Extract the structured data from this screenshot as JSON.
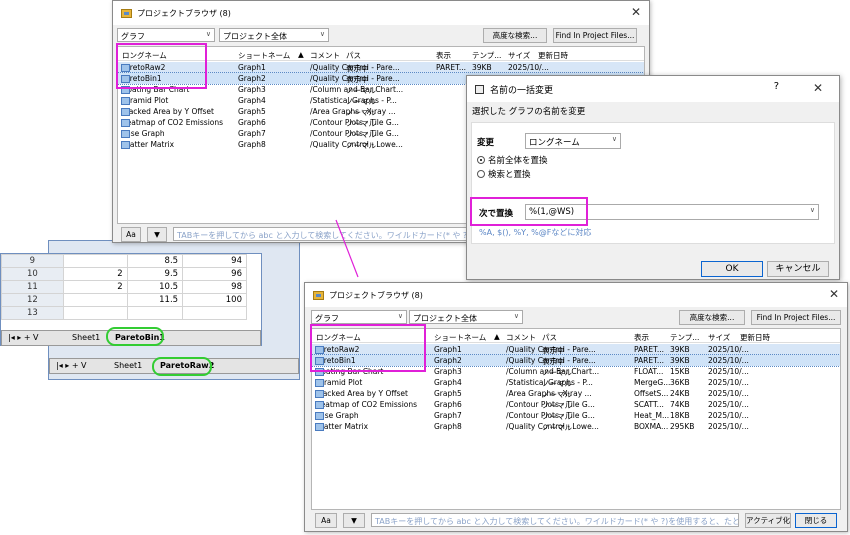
{
  "top_browser": {
    "title": "プロジェクトブラウザ  (8)",
    "close": "✕",
    "filter1": "グラフ",
    "filter2": "プロジェクト全体",
    "adv_btn": "高度な検索...",
    "find_btn": "Find In Project Files...",
    "headers": [
      "ロングネーム",
      "ショートネーム",
      "",
      "コメント",
      "パス",
      "表示",
      "テンプ...",
      "サイズ",
      "更新日時"
    ],
    "rows": [
      [
        "ParetoRaw2",
        "Graph1",
        "",
        "/Quality Control - Pare...",
        "表示中",
        "PARET...",
        "39KB",
        "2025/10/..."
      ],
      [
        "ParetoBin1",
        "Graph2",
        "",
        "/Quality Control - Pare...",
        "表示中",
        "",
        "",
        ""
      ],
      [
        "Floating Bar Chart",
        "Graph3",
        "",
        "/Column and Bar Chart...",
        "ノーマル",
        "",
        "",
        ""
      ],
      [
        "Pyramid Plot",
        "Graph4",
        "",
        "/Statistical Graphs - P...",
        "ノーマル",
        "",
        "",
        ""
      ],
      [
        "Stacked Area by Y Offset",
        "Graph5",
        "Plot a Y...",
        "/Area Graphs - X-ray ...",
        "ノーマル",
        "",
        "",
        ""
      ],
      [
        "Heatmap of CO2 Emissions",
        "Graph6",
        "",
        "/Contour Plots - Tile G...",
        "ノーマル",
        "",
        "",
        ""
      ],
      [
        "Base Graph",
        "Graph7",
        "",
        "/Contour Plots - Tile G...",
        "ノーマル",
        "",
        "",
        ""
      ],
      [
        "Scatter Matrix",
        "Graph8",
        "",
        "/Quality Control - Lowe...",
        "ノーマル",
        "",
        "",
        ""
      ]
    ],
    "aa": "Aa",
    "filter_icon": "filter-icon",
    "search_hint": "TABキーを押してから abc と入力して検索してください。ワイルドカード(* や ?)を使用"
  },
  "rename_dialog": {
    "title": "名前の一括変更",
    "help": "?",
    "close": "✕",
    "heading": "選択した グラフの名前を変更",
    "change_label": "変更",
    "change_value": "ロングネーム",
    "radio1": "名前全体を置換",
    "radio2": "検索と置換",
    "replace_label": "次で置換",
    "replace_value": "%(1,@WS)",
    "hint": "%A, $(), %Y, %@Fなどに対応",
    "ok": "OK",
    "cancel": "キャンセル"
  },
  "sheets": {
    "rows": [
      [
        "9",
        "",
        "8.5",
        "94"
      ],
      [
        "10",
        "2",
        "9.5",
        "96"
      ],
      [
        "11",
        "2",
        "10.5",
        "98"
      ],
      [
        "12",
        "",
        "11.5",
        "100"
      ],
      [
        "13",
        "",
        "",
        ""
      ]
    ],
    "tabs1": [
      "Sheet1",
      "ParetoBin1"
    ],
    "tabs2": [
      "Sheet1",
      "ParetoRaw2"
    ],
    "nav": "|◂ ▸ + V"
  },
  "bottom_browser": {
    "title": "プロジェクトブラウザ  (8)",
    "close": "✕",
    "filter1": "グラフ",
    "filter2": "プロジェクト全体",
    "adv_btn": "高度な検索...",
    "find_btn": "Find In Project Files...",
    "headers": [
      "ロングネーム",
      "ショートネーム",
      "",
      "コメント",
      "パス",
      "表示",
      "テンプ...",
      "サイズ",
      "更新日時"
    ],
    "rows": [
      [
        "ParetoRaw2",
        "Graph1",
        "",
        "/Quality Control - Pare...",
        "表示中",
        "PARET...",
        "39KB",
        "2025/10/..."
      ],
      [
        "ParetoBin1",
        "Graph2",
        "",
        "/Quality Control - Pare...",
        "表示中",
        "PARET...",
        "39KB",
        "2025/10/..."
      ],
      [
        "Floating Bar Chart",
        "Graph3",
        "",
        "/Column and Bar Chart...",
        "ノーマル",
        "FLOAT...",
        "15KB",
        "2025/10/..."
      ],
      [
        "Pyramid Plot",
        "Graph4",
        "",
        "/Statistical Graphs - P...",
        "ノーマル",
        "MergeG...",
        "36KB",
        "2025/10/..."
      ],
      [
        "Stacked Area by Y Offset",
        "Graph5",
        "Plot a Y...",
        "/Area Graphs - X-ray ...",
        "ノーマル",
        "OffsetS...",
        "24KB",
        "2025/10/..."
      ],
      [
        "Heatmap of CO2 Emissions",
        "Graph6",
        "",
        "/Contour Plots - Tile G...",
        "ノーマル",
        "SCATT...",
        "74KB",
        "2025/10/..."
      ],
      [
        "Base Graph",
        "Graph7",
        "",
        "/Contour Plots - Tile G...",
        "ノーマル",
        "Heat_M...",
        "18KB",
        "2025/10/..."
      ],
      [
        "Scatter Matrix",
        "Graph8",
        "",
        "/Quality Control - Lowe...",
        "ノーマル",
        "BOXMA...",
        "295KB",
        "2025/10/..."
      ]
    ],
    "aa": "Aa",
    "search_hint": "TABキーを押してから abc と入力して検索してください。ワイルドカード(* や ?)を使用すると、たとえば *abc",
    "active_btn": "アクティブ化",
    "close_btn": "閉じる"
  },
  "colors": {
    "magenta": "#e020d8",
    "green": "#33cc33",
    "highlight": "#d7e6f7"
  }
}
